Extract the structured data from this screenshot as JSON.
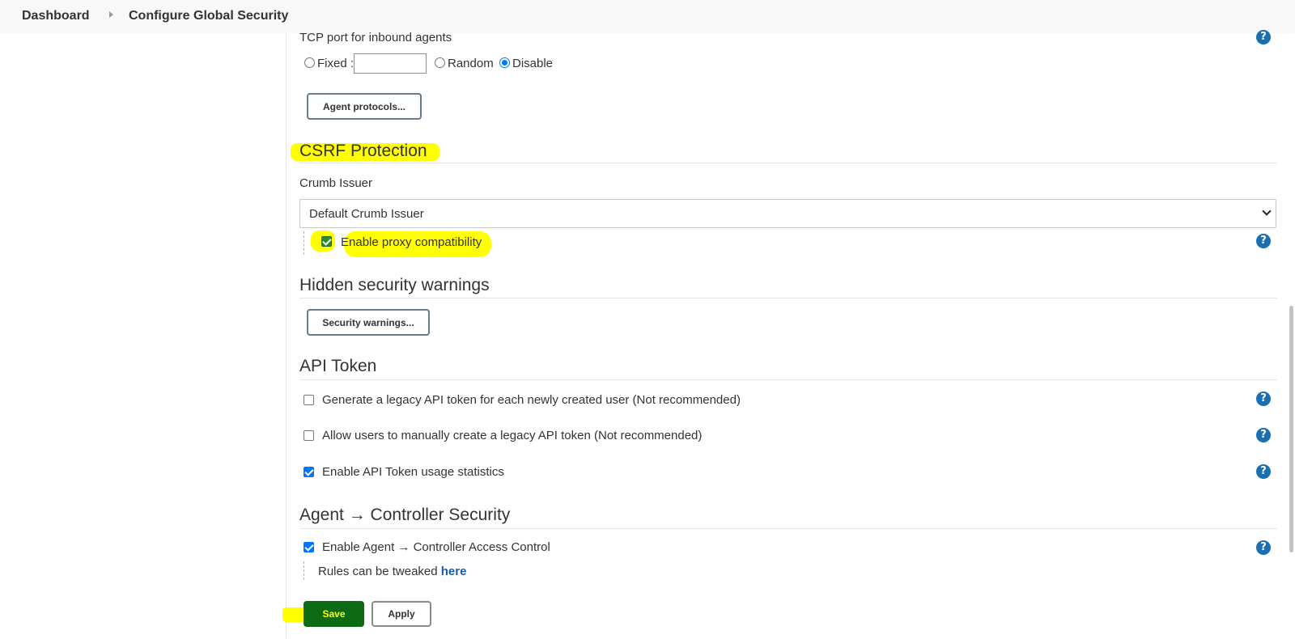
{
  "breadcrumb": {
    "items": [
      "Dashboard",
      "Configure Global Security"
    ]
  },
  "agents": {
    "label": "TCP port for inbound agents",
    "fixed_label": "Fixed :",
    "fixed_value": "",
    "random_label": "Random",
    "disable_label": "Disable",
    "selected": "Disable",
    "protocols_button": "Agent protocols..."
  },
  "csrf": {
    "heading": "CSRF Protection",
    "crumb_issuer_label": "Crumb Issuer",
    "crumb_issuer_value": "Default Crumb Issuer",
    "proxy_label": "Enable proxy compatibility",
    "proxy_checked": true
  },
  "hidden_warnings": {
    "heading": "Hidden security warnings",
    "button": "Security warnings..."
  },
  "api_token": {
    "heading": "API Token",
    "options": [
      {
        "label": "Generate a legacy API token for each newly created user (Not recommended)",
        "checked": false
      },
      {
        "label": "Allow users to manually create a legacy API token (Not recommended)",
        "checked": false
      },
      {
        "label": "Enable API Token usage statistics",
        "checked": true
      }
    ]
  },
  "agent_controller": {
    "heading": "Agent → Controller Security",
    "access_control_label": "Enable Agent → Controller Access Control",
    "access_control_checked": true,
    "rules_text": "Rules can be tweaked",
    "rules_link": "here"
  },
  "actions": {
    "save": "Save",
    "apply": "Apply"
  },
  "help_icon_glyph": "?",
  "colors": {
    "highlight": "#ffff00",
    "link": "#1a5da8",
    "help": "#1a6fb0",
    "save_bg": "#0b6a12"
  }
}
